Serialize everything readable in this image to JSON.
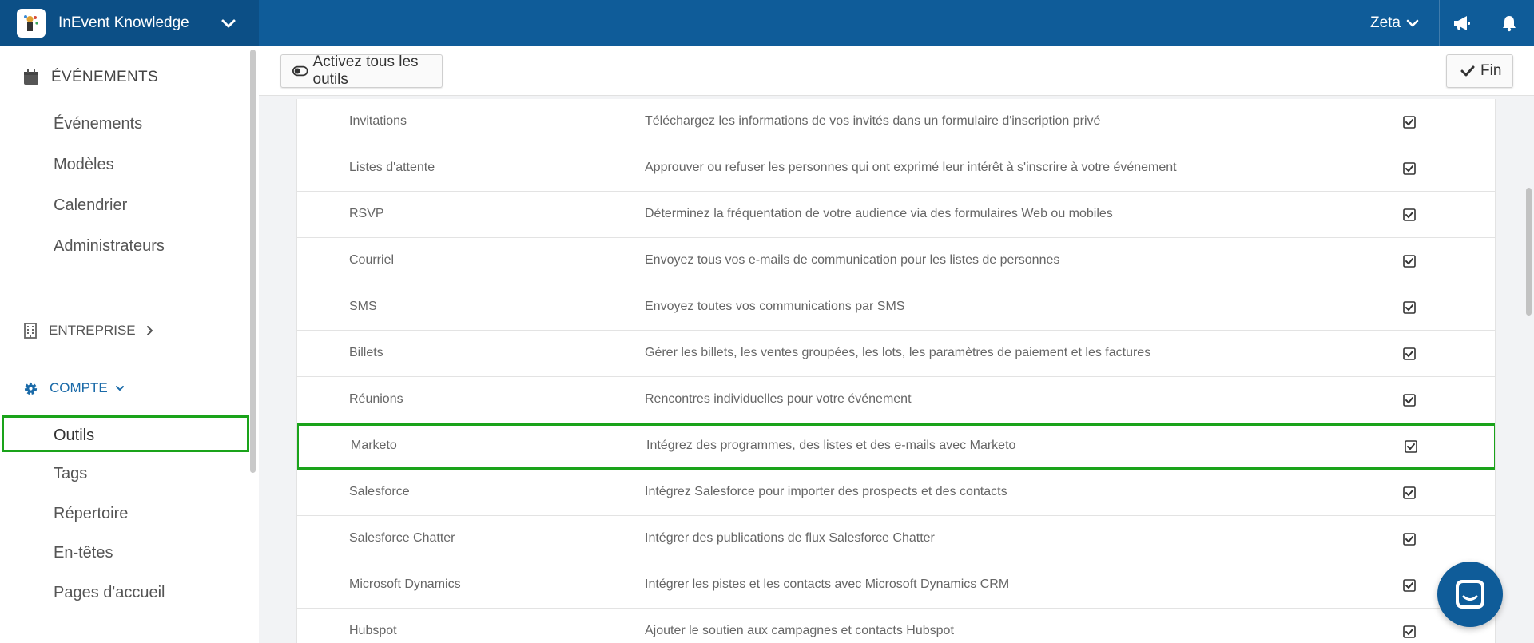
{
  "header": {
    "app_name": "InEvent Knowledge",
    "user": "Zeta"
  },
  "sidebar": {
    "events_heading": "ÉVÉNEMENTS",
    "events_items": [
      "Événements",
      "Modèles",
      "Calendrier",
      "Administrateurs"
    ],
    "company_heading": "ENTREPRISE",
    "account_heading": "COMPTE",
    "account_items": [
      "Outils",
      "Tags",
      "Répertoire",
      "En-têtes",
      "Pages d'accueil"
    ],
    "active_item": "Outils"
  },
  "toolbar": {
    "toggle_all_label": "Activez tous les outils",
    "done_label": "Fin"
  },
  "tools": [
    {
      "name": "Invitations",
      "description": "Téléchargez les informations de vos invités dans un formulaire d'inscription privé",
      "enabled": true
    },
    {
      "name": "Listes d'attente",
      "description": "Approuver ou refuser les personnes qui ont exprimé leur intérêt à s'inscrire à votre événement",
      "enabled": true
    },
    {
      "name": "RSVP",
      "description": "Déterminez la fréquentation de votre audience via des formulaires Web ou mobiles",
      "enabled": true
    },
    {
      "name": "Courriel",
      "description": "Envoyez tous vos e-mails de communication pour les listes de personnes",
      "enabled": true
    },
    {
      "name": "SMS",
      "description": "Envoyez toutes vos communications par SMS",
      "enabled": true
    },
    {
      "name": "Billets",
      "description": "Gérer les billets, les ventes groupées, les lots, les paramètres de paiement et les factures",
      "enabled": true
    },
    {
      "name": "Réunions",
      "description": "Rencontres individuelles pour votre événement",
      "enabled": true
    },
    {
      "name": "Marketo",
      "description": "Intégrez des programmes, des listes et des e-mails avec Marketo",
      "enabled": true
    },
    {
      "name": "Salesforce",
      "description": "Intégrez Salesforce pour importer des prospects et des contacts",
      "enabled": true
    },
    {
      "name": "Salesforce Chatter",
      "description": "Intégrer des publications de flux Salesforce Chatter",
      "enabled": true
    },
    {
      "name": "Microsoft Dynamics",
      "description": "Intégrer les pistes et les contacts avec Microsoft Dynamics CRM",
      "enabled": true
    },
    {
      "name": "Hubspot",
      "description": "Ajouter le soutien aux campagnes et contacts Hubspot",
      "enabled": true
    }
  ],
  "highlighted_tool": "Marketo",
  "colors": {
    "topbar": "#0f5c99",
    "brand_bg": "#0c4f86",
    "accent": "#1a6aa8",
    "highlight": "#1aa31a"
  }
}
